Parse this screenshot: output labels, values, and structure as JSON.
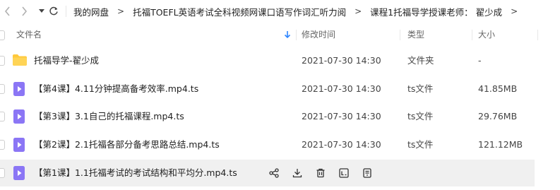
{
  "nav": {
    "back_icon": "chevron-left-icon",
    "forward_icon": "chevron-right-icon",
    "dropdown_icon": "caret-down-icon",
    "refresh_icon": "refresh-icon"
  },
  "breadcrumb": {
    "items": [
      {
        "label": "我的网盘"
      },
      {
        "label": "托福TOEFL英语考试全科视频网课口语写作词汇听力阅"
      },
      {
        "label": "课程1托福导学授课老师： 翟少成"
      }
    ],
    "separator": ">"
  },
  "table": {
    "columns": {
      "name": "文件名",
      "modified": "修改时间",
      "type": "类型",
      "size": "大小"
    },
    "sort_icon": "arrow-down-icon",
    "rows": [
      {
        "name": "托福导学-翟少成",
        "modified": "2021-07-30 14:30",
        "type": "文件夹",
        "size": "-",
        "icon": "folder-icon"
      },
      {
        "name": "【第4课】4.11分钟提高备考效率.mp4.ts",
        "modified": "2021-07-30 14:30",
        "type": "ts文件",
        "size": "41.85MB",
        "icon": "video-file-icon"
      },
      {
        "name": "【第3课】3.1自己的托福课程.mp4.ts",
        "modified": "2021-07-30 14:30",
        "type": "ts文件",
        "size": "29.76MB",
        "icon": "video-file-icon"
      },
      {
        "name": "【第2课】2.1托福各部分备考思路总结.mp4.ts",
        "modified": "2021-07-30 14:30",
        "type": "ts文件",
        "size": "121.12MB",
        "icon": "video-file-icon"
      },
      {
        "name": "【第1课】1.1托福考试的考试结构和平均分.mp4.ts",
        "modified": "",
        "type": "",
        "size": "",
        "icon": "video-file-icon"
      }
    ]
  },
  "row_actions": [
    "share-icon",
    "download-icon",
    "delete-icon",
    "rename-icon",
    "more-icon"
  ],
  "colors": {
    "folder": "#ffc93c",
    "video": "#8b76f5",
    "accent": "#2f86ff"
  }
}
